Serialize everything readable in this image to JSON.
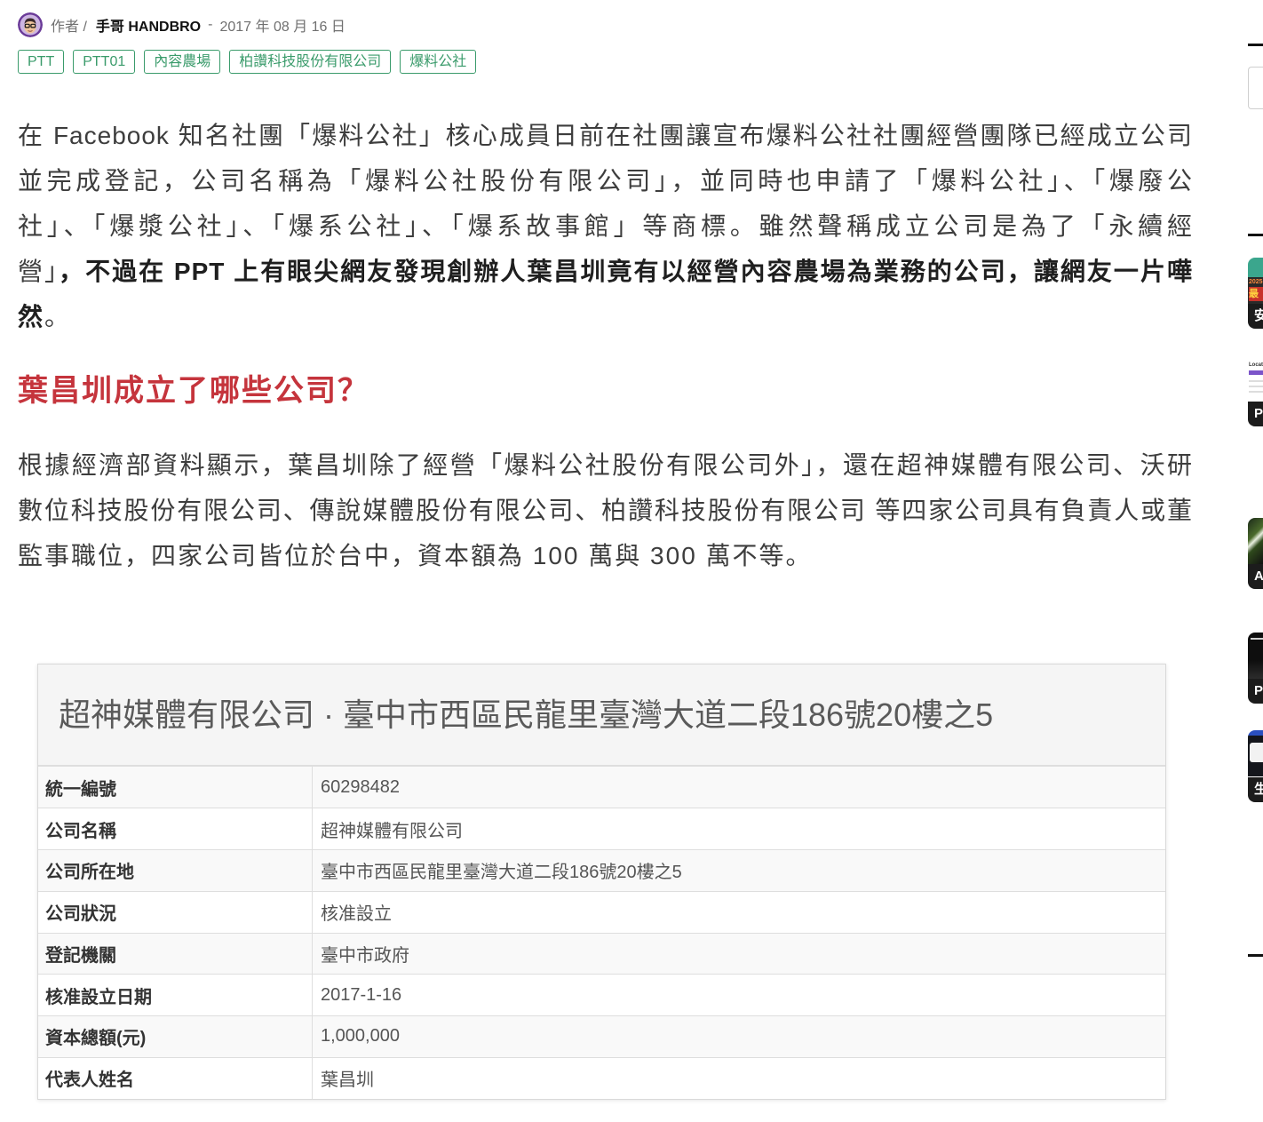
{
  "author": {
    "prefix": "作者 /",
    "name": "手哥 HANDBRO",
    "separator": "-",
    "date": "2017 年 08 月 16 日"
  },
  "tags": [
    "PTT",
    "PTT01",
    "內容農場",
    "柏讚科技股份有限公司",
    "爆料公社"
  ],
  "article": {
    "intro_lines": [
      [
        "在 Facebook 知名社團「爆料公社」核心成員日前在社團讓宣布爆料公社社團經營團隊已經成立公司"
      ],
      [
        "並完成登記，公司名稱為「爆料公社股份有限公司」，並同時也申請了「爆料公社」、「爆廢公"
      ],
      [
        "社」、「爆漿公社」、「爆系公社」、「爆系故事館」等商標。雖然聲稱成立公司是為了「永續經"
      ],
      [
        "營」",
        "，不過在 PPT 上有眼尖網友發現創辦人葉昌圳竟有以經營內容農場為業務的公司，讓網友一片嘩"
      ],
      [
        "然",
        "。"
      ]
    ],
    "section_heading": "葉昌圳成立了哪些公司？",
    "body_lines": [
      "根據經濟部資料顯示，葉昌圳除了經營「爆料公社股份有限公司外」，還在超神媒體有限公司、沃研",
      "數位科技股份有限公司、傳說媒體股份有限公司、柏讚科技股份有限公司 等四家公司具有負責人或董",
      "監事職位，四家公司皆位於台中，資本額為 100 萬與 300 萬不等。"
    ],
    "registry": {
      "title": "超神媒體有限公司 · 臺中市西區民龍里臺灣大道二段186號20樓之5",
      "rows": [
        {
          "label": "統一編號",
          "value": "60298482"
        },
        {
          "label": "公司名稱",
          "value": "超神媒體有限公司"
        },
        {
          "label": "公司所在地",
          "value": "臺中市西區民龍里臺灣大道二段186號20樓之5"
        },
        {
          "label": "公司狀況",
          "value": "核准設立"
        },
        {
          "label": "登記機關",
          "value": "臺中市政府"
        },
        {
          "label": "核准設立日期",
          "value": "2017-1-16"
        },
        {
          "label": "資本總額(元)",
          "value": "1,000,000"
        },
        {
          "label": "代表人姓名",
          "value": "葉昌圳"
        }
      ]
    }
  },
  "sidebar": {
    "cards": [
      {
        "title": "安",
        "image_text": [
          "2025",
          "最"
        ]
      },
      {
        "title": "P",
        "image_text": [
          "Locati"
        ]
      },
      {
        "title": "A"
      },
      {
        "title": "P"
      },
      {
        "title": "生"
      }
    ]
  },
  "theme": {
    "tag_color": "#3a9b6b",
    "heading_color": "#c5343c",
    "body_text_color": "#3d3d3d",
    "avatar_ring_color": "#6a3a98"
  }
}
